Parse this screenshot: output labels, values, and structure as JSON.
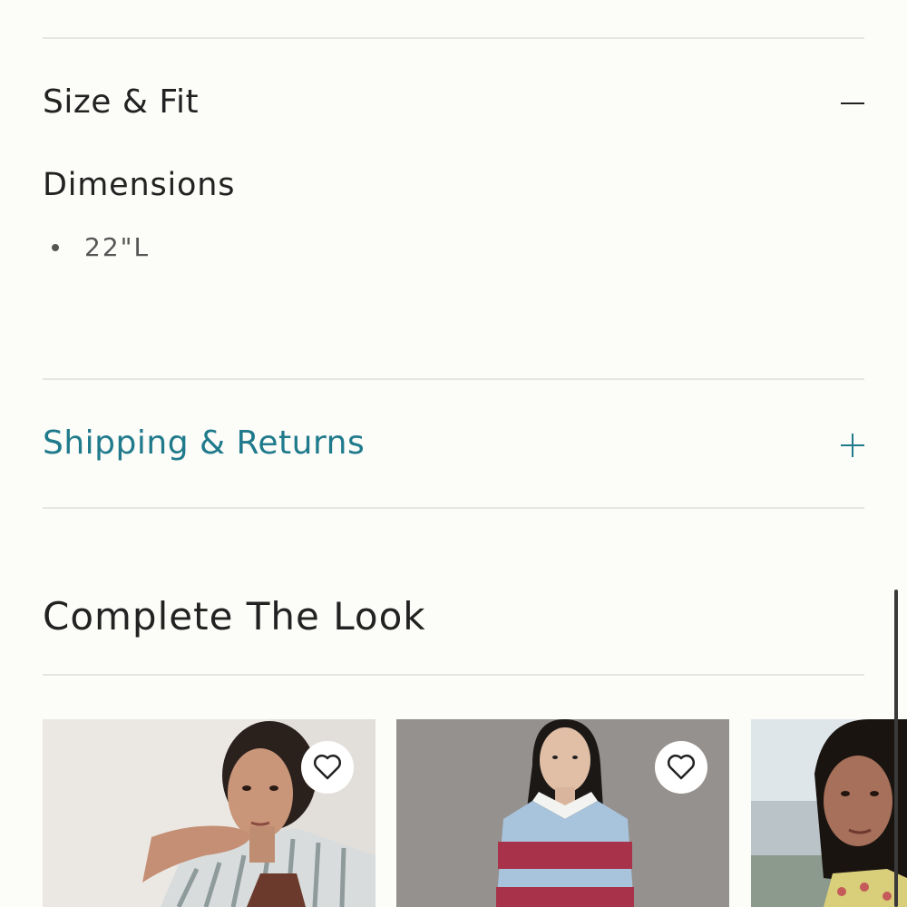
{
  "accordion": {
    "size_fit": {
      "title": "Size & Fit",
      "state_icon": "minus-icon",
      "dimensions_heading": "Dimensions",
      "dimensions": [
        "22\"L"
      ]
    },
    "shipping_returns": {
      "title": "Shipping & Returns",
      "state_icon": "plus-icon",
      "color": "#1f7a8c"
    }
  },
  "complete_the_look": {
    "title": "Complete The Look",
    "products": [
      {
        "image": "woman-striped-shirt-photo",
        "favorite_icon": "heart-icon"
      },
      {
        "image": "woman-rugby-shirt-photo",
        "favorite_icon": "heart-icon"
      },
      {
        "image": "woman-floral-top-photo"
      }
    ]
  },
  "colors": {
    "background": "#fcfcf8",
    "text": "#222222",
    "accent": "#1f7a8c",
    "divider": "#e5e5e1"
  }
}
